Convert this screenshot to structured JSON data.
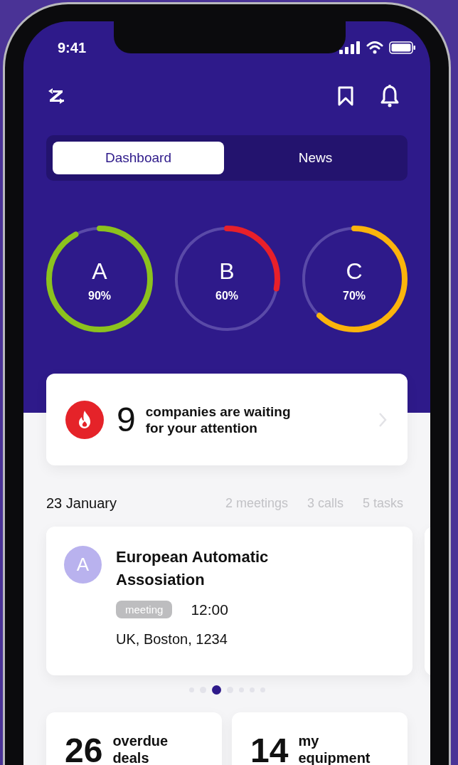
{
  "status_bar": {
    "time": "9:41"
  },
  "tabs": [
    {
      "label": "Dashboard",
      "selected": true
    },
    {
      "label": "News",
      "selected": false
    }
  ],
  "rings": [
    {
      "letter": "A",
      "reading": "90%",
      "level": 0.92,
      "color": "#8cc21e"
    },
    {
      "letter": "B",
      "reading": "60%",
      "level": 0.28,
      "color": "#e8202a"
    },
    {
      "letter": "C",
      "reading": "70%",
      "level": 0.62,
      "color": "#fbb40c"
    }
  ],
  "alert": {
    "count": "9",
    "text": "companies are waiting for your attention"
  },
  "agenda": {
    "date": "23 January",
    "summary": [
      "2 meetings",
      "3 calls",
      "5 tasks"
    ]
  },
  "meeting": {
    "initial": "A",
    "title": "European Automatic Assosiation",
    "tag": "meeting",
    "time": "12:00",
    "address": "UK, Boston, 1234"
  },
  "pager": [
    {
      "selected": false
    },
    {
      "selected": false
    },
    {
      "selected": true
    },
    {
      "selected": false
    },
    {
      "selected": false
    },
    {
      "selected": false
    },
    {
      "selected": false
    }
  ],
  "stats": [
    {
      "count": "26",
      "label": "overdue deals"
    },
    {
      "count": "14",
      "label": "my equipment"
    }
  ]
}
